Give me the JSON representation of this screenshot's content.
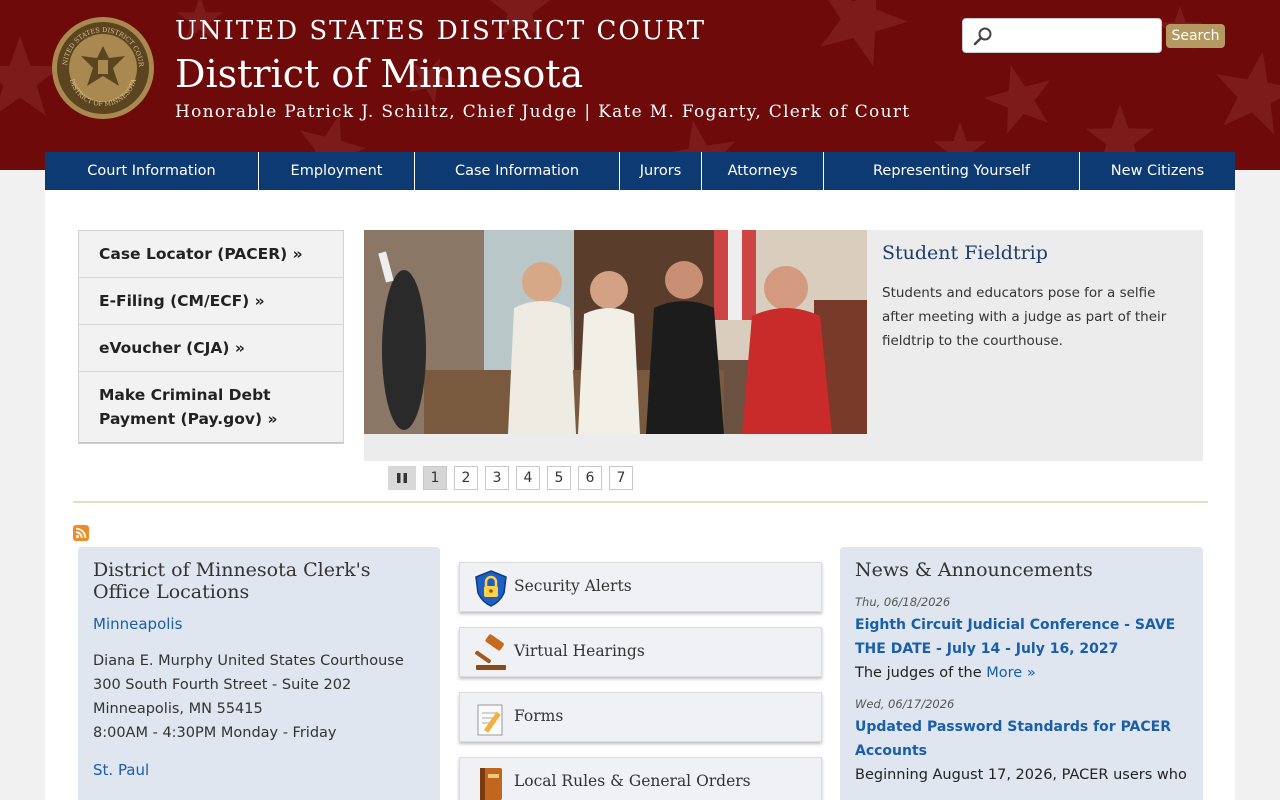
{
  "header": {
    "line1": "UNITED STATES DISTRICT COURT",
    "line2": "District of Minnesota",
    "line3": "Honorable Patrick J. Schiltz, Chief Judge | Kate M. Fogarty, Clerk of Court",
    "seal_top_text": "UNITED STATES DISTRICT COURT",
    "seal_bottom_text": "DISTRICT OF MINNESOTA",
    "search_placeholder": "",
    "search_button": "Search"
  },
  "nav": [
    {
      "label": "Court Information"
    },
    {
      "label": "Employment"
    },
    {
      "label": "Case Information"
    },
    {
      "label": "Jurors"
    },
    {
      "label": "Attorneys"
    },
    {
      "label": "Representing Yourself"
    },
    {
      "label": "New Citizens"
    }
  ],
  "quick_links": [
    {
      "label": "Case Locator (PACER) »"
    },
    {
      "label": "E-Filing (CM/ECF) »"
    },
    {
      "label": "eVoucher (CJA) »"
    },
    {
      "label": "Make Criminal Debt Payment (Pay.gov) »"
    }
  ],
  "slide": {
    "title": "Student Fieldtrip",
    "text": "Students and educators pose for a selfie after meeting with a judge as part of their fieldtrip to the courthouse."
  },
  "pager": {
    "pages": [
      "1",
      "2",
      "3",
      "4",
      "5",
      "6",
      "7"
    ],
    "active": "1"
  },
  "locations": {
    "title": "District of Minnesota Clerk's Office Locations",
    "city1": "Minneapolis",
    "address": [
      "Diana E. Murphy United States Courthouse",
      "300 South Fourth Street - Suite 202",
      "Minneapolis, MN 55415",
      "8:00AM - 4:30PM Monday - Friday"
    ],
    "city2": "St. Paul"
  },
  "tiles": [
    {
      "label": "Security Alerts",
      "icon": "lock-shield-icon"
    },
    {
      "label": "Virtual Hearings",
      "icon": "gavel-icon"
    },
    {
      "label": "Forms",
      "icon": "form-pencil-icon"
    },
    {
      "label": "Local Rules & General Orders",
      "icon": "book-icon"
    }
  ],
  "news": {
    "title": "News & Announcements",
    "items": [
      {
        "date": "Thu, 06/18/2026",
        "title": "Eighth Circuit Judicial Conference - SAVE THE DATE - July 14 - July 16, 2027",
        "snippet": "The judges of the",
        "more": "More »"
      },
      {
        "date": "Wed, 06/17/2026",
        "title": "Updated Password Standards for PACER Accounts",
        "snippet": "Beginning August 17, 2026, PACER users who"
      }
    ]
  },
  "colors": {
    "header_red": "#6e0a0a",
    "nav_blue": "#0d3a73",
    "link_blue": "#1a5ea8",
    "search_gold": "#b49a62",
    "panel_blue": "#dfe6ef"
  }
}
